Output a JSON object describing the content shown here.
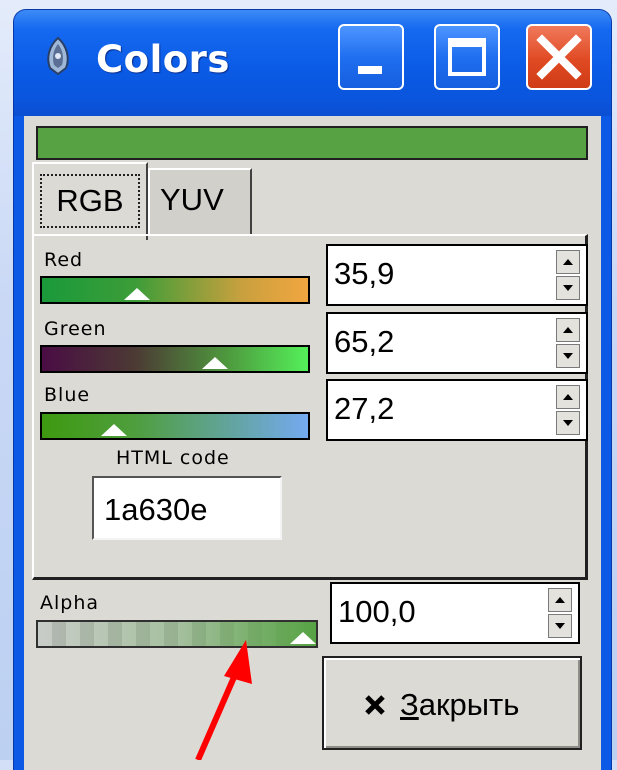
{
  "window": {
    "title": "Colors"
  },
  "preview": {
    "color": "#57a344"
  },
  "tabs": [
    {
      "label": "RGB",
      "selected": true
    },
    {
      "label": "YUV",
      "selected": false
    }
  ],
  "channels": [
    {
      "label": "Red",
      "value": "35,9",
      "level": 35.9
    },
    {
      "label": "Green",
      "value": "65,2",
      "level": 65.2
    },
    {
      "label": "Blue",
      "value": "27,2",
      "level": 27.2
    }
  ],
  "html_code": {
    "label": "HTML code",
    "value": "1a630e"
  },
  "alpha": {
    "label": "Alpha",
    "value": "100,0",
    "level": 100.0
  },
  "close_button": {
    "mnemonic": "З",
    "rest": "акрыть"
  },
  "colors": {
    "title_bar": "#0b5be6",
    "close_red": "#e04a23",
    "dialog_bg": "#dcdad5",
    "annotation_arrow": "#ff0000"
  },
  "icons": [
    "app-icon",
    "minimize-icon",
    "maximize-icon",
    "close-icon",
    "x-icon",
    "spin-up-icon",
    "spin-down-icon"
  ]
}
